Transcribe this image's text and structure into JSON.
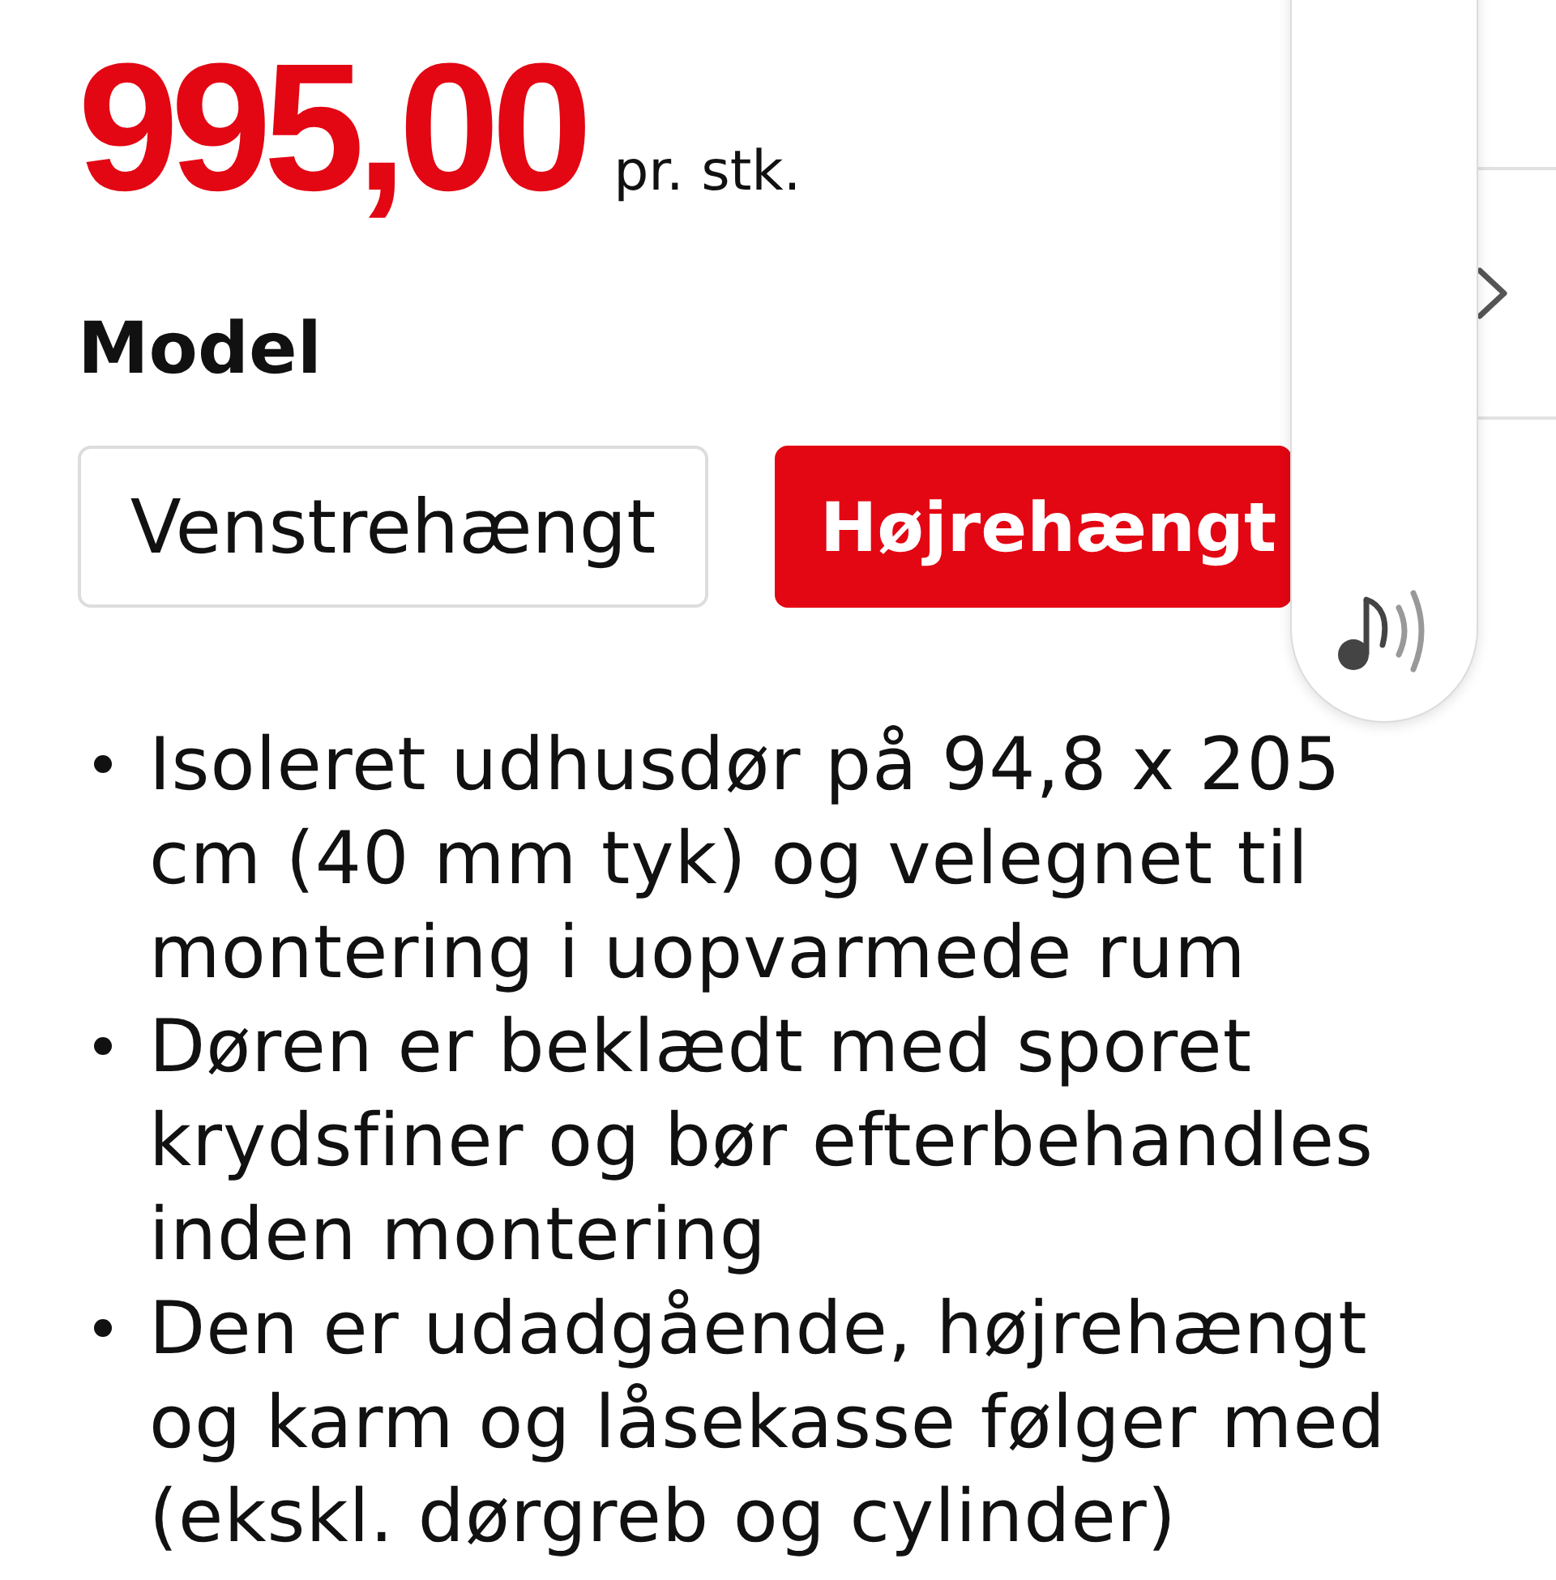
{
  "price": {
    "amount": "995,00",
    "unit": "pr. stk."
  },
  "model": {
    "heading": "Model",
    "options": [
      {
        "label": "Venstrehængt",
        "selected": false
      },
      {
        "label": "Højrehængt",
        "selected": true
      }
    ]
  },
  "features": [
    "Isoleret udhusdør på 94,8 x 205 cm (40 mm tyk) og velegnet til montering i uopvarmede rum",
    "Døren er beklædt med sporet krydsfiner og bør efterbehandles inden montering",
    "Den er udadgående, højrehængt og karm og låsekasse følger med (ekskl. dørgreb og cylinder)"
  ]
}
